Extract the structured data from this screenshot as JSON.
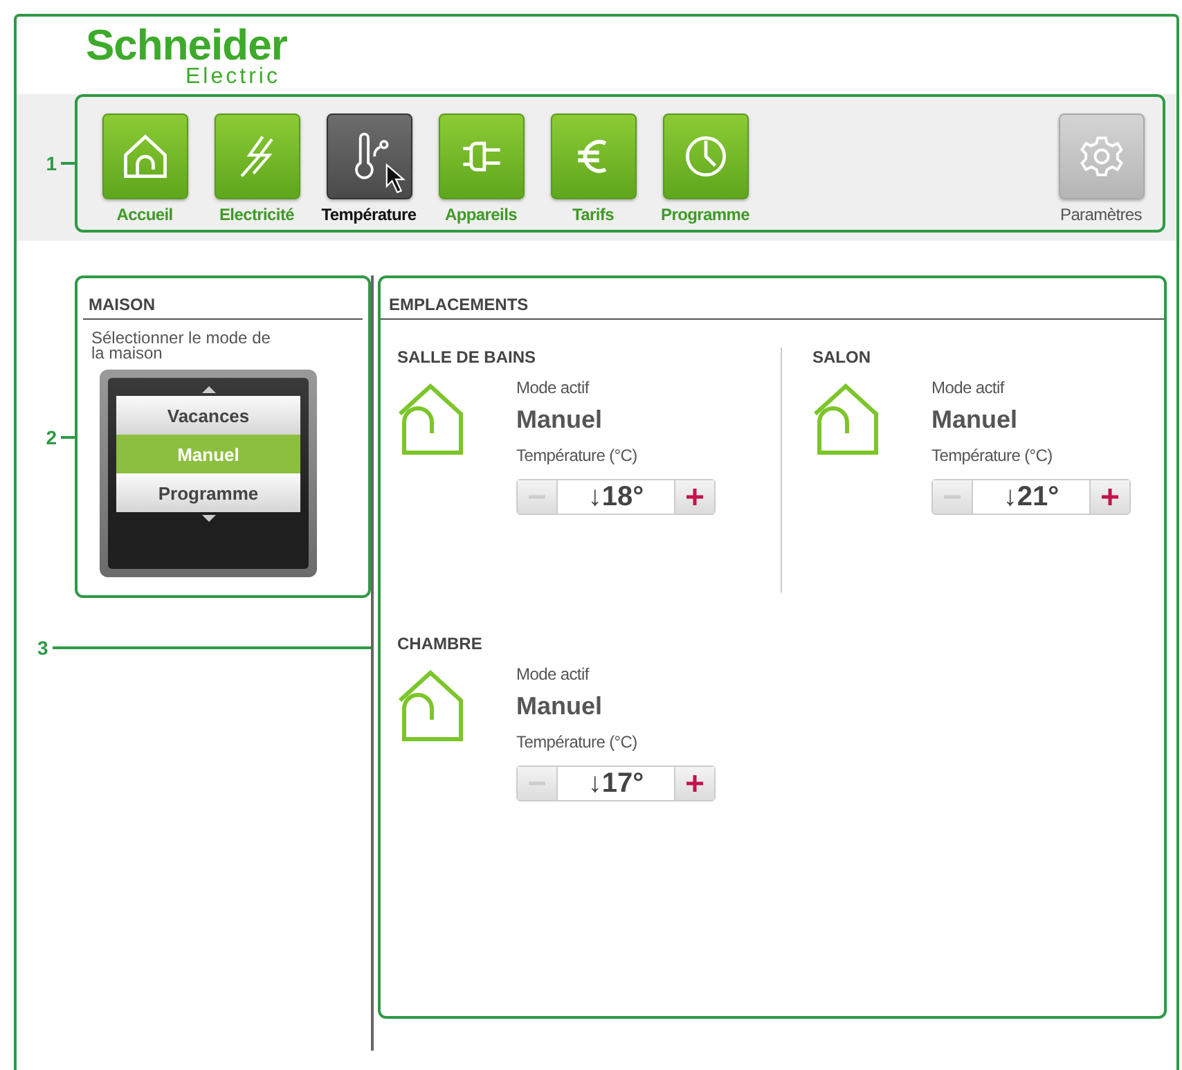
{
  "logo": {
    "name": "Schneider",
    "sub": "Electric"
  },
  "callouts": [
    "1",
    "2",
    "3"
  ],
  "nav": [
    {
      "kind": "home",
      "label": "Accueil",
      "selected": false
    },
    {
      "kind": "bolt",
      "label": "Electricité",
      "selected": false
    },
    {
      "kind": "thermometer",
      "label": "Température",
      "selected": true
    },
    {
      "kind": "plug",
      "label": "Appareils",
      "selected": false
    },
    {
      "kind": "euro",
      "label": "Tarifs",
      "selected": false
    },
    {
      "kind": "clock",
      "label": "Programme",
      "selected": false
    }
  ],
  "settings": {
    "label": "Paramètres"
  },
  "maison": {
    "title": "MAISON",
    "hint": "Sélectionner le mode de la maison",
    "modes": [
      {
        "label": "Vacances",
        "selected": false
      },
      {
        "label": "Manuel",
        "selected": true
      },
      {
        "label": "Programme",
        "selected": false
      }
    ]
  },
  "emplacements": {
    "title": "EMPLACEMENTS",
    "rooms": [
      {
        "name": "SALLE DE BAINS",
        "mode_label": "Mode actif",
        "mode": "Manuel",
        "temp_label": "Température (°C)",
        "temp": "↓18°"
      },
      {
        "name": "SALON",
        "mode_label": "Mode actif",
        "mode": "Manuel",
        "temp_label": "Température (°C)",
        "temp": "↓21°"
      },
      {
        "name": "CHAMBRE",
        "mode_label": "Mode actif",
        "mode": "Manuel",
        "temp_label": "Température (°C)",
        "temp": "↓17°"
      }
    ]
  }
}
